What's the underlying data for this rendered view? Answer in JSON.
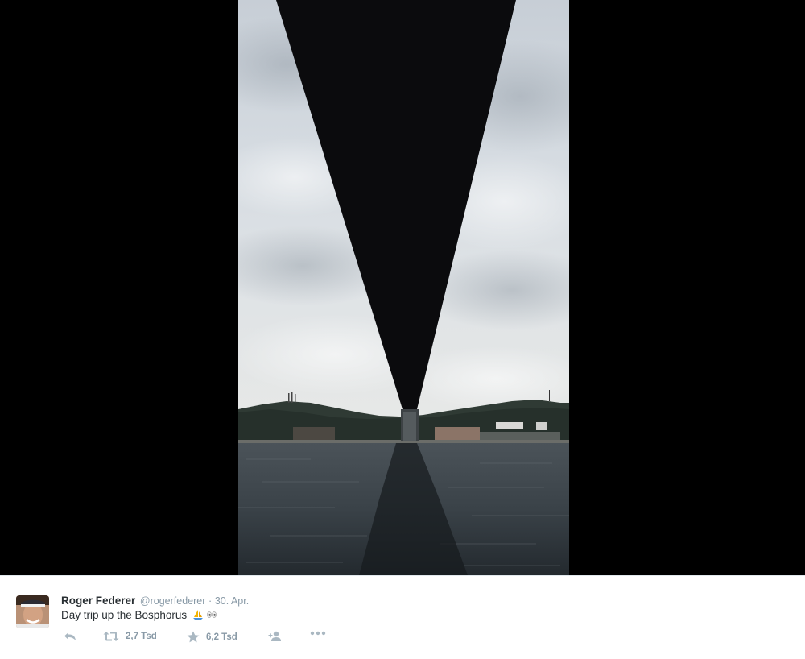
{
  "tweet": {
    "author_name": "Roger Federer",
    "handle": "@rogerfederer",
    "separator": "·",
    "date": "30. Apr.",
    "text": "Day trip up the Bosphorus",
    "emoji": [
      "sailboat-emoji",
      "eyes-emoji"
    ]
  },
  "actions": {
    "reply_icon": "reply-icon",
    "retweet_icon": "retweet-icon",
    "retweet_count": "2,7 Tsd",
    "favorite_icon": "star-icon",
    "favorite_count": "6,2 Tsd",
    "follow_icon": "follow-user-icon",
    "more_icon": "more-icon"
  },
  "colors": {
    "muted_text": "#8899a6",
    "text": "#292f33",
    "backdrop": "#000000"
  }
}
